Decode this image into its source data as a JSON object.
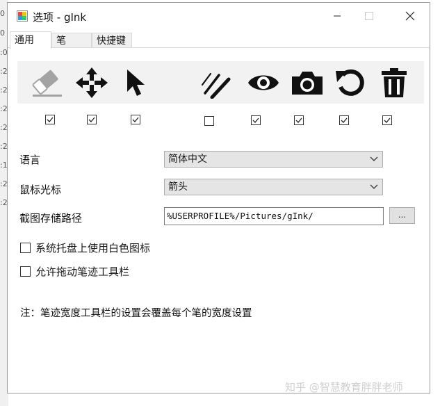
{
  "background_fragments": [
    "0",
    "0",
    ":0",
    ":2",
    ":2",
    ":2",
    ":2",
    ":2",
    ":1",
    ":2",
    ":2"
  ],
  "window": {
    "title": "选项 - gInk",
    "controls": [
      "minimize-icon",
      "maximize-icon",
      "close-icon"
    ]
  },
  "tabs": [
    {
      "label": "通用",
      "active": true
    },
    {
      "label": "笔",
      "active": false
    },
    {
      "label": "快捷键",
      "active": false
    }
  ],
  "tools": [
    {
      "icon": "eraser-icon",
      "checked": true
    },
    {
      "icon": "move-icon",
      "checked": true
    },
    {
      "icon": "pointer-icon",
      "checked": true
    },
    {
      "icon": "pen-width-icon",
      "checked": false
    },
    {
      "icon": "eye-icon",
      "checked": true
    },
    {
      "icon": "camera-icon",
      "checked": true
    },
    {
      "icon": "undo-icon",
      "checked": true
    },
    {
      "icon": "trash-icon",
      "checked": true
    }
  ],
  "settings": {
    "language_label": "语言",
    "language_value": "简体中文",
    "cursor_label": "鼠标光标",
    "cursor_value": "箭头",
    "snapshot_label": "截图存储路径",
    "snapshot_path": "%USERPROFILE%/Pictures/gInk/",
    "browse_label": "..."
  },
  "options": [
    {
      "label": "系统托盘上使用白色图标",
      "checked": false
    },
    {
      "label": "允许拖动笔迹工具栏",
      "checked": false
    }
  ],
  "note": "注：笔迹宽度工具栏的设置会覆盖每个笔的宽度设置",
  "watermark": "知乎 @智慧教育胖胖老师",
  "colors": {
    "toolbar_bg": "#f2f2f2",
    "window_border": "#9a9a9a",
    "icon": "#111111",
    "eraser_grey": "#9e9e9e"
  }
}
